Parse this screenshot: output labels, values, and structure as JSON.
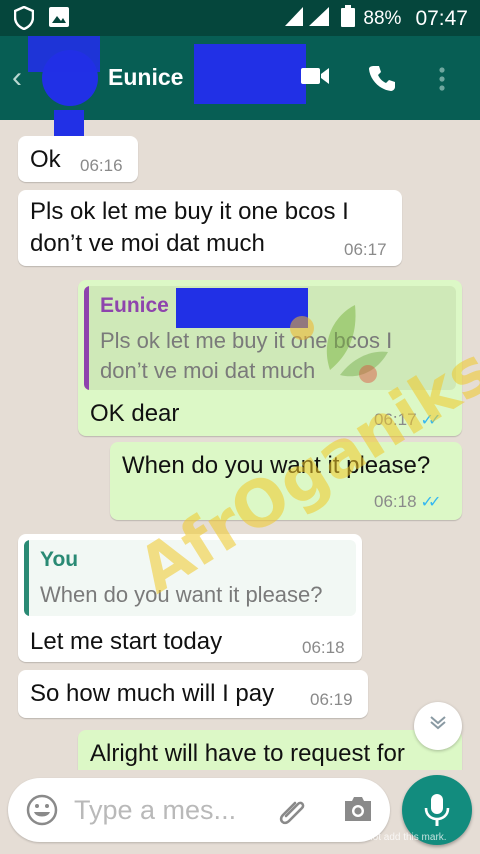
{
  "status_bar": {
    "battery": "88%",
    "time": "07:47"
  },
  "header": {
    "contact_name": "Eunice"
  },
  "messages": [
    {
      "text": "Ok",
      "time": "06:16"
    },
    {
      "text_lines": [
        "Pls ok let me buy it one bcos I",
        "don’t ve moi dat much"
      ],
      "time": "06:17"
    },
    {
      "quote_author": "Eunice",
      "quote_lines": [
        "Pls ok let me buy it one bcos I",
        "don’t ve moi dat much"
      ],
      "text": "OK dear",
      "time": "06:17"
    },
    {
      "text": "When do you want it please?",
      "time": "06:18"
    },
    {
      "quote_author": "You",
      "quote_text": "When do you want it please?",
      "text": "Let me start today",
      "time": "06:18"
    },
    {
      "text": "So how much will I pay",
      "time": "06:19"
    },
    {
      "text": "Alright will have to request for"
    }
  ],
  "input": {
    "placeholder": "Type a mes..."
  },
  "watermark": {
    "text": "AfrOganiks"
  },
  "footer_note": "Processed using the free version of Watermarkly. The paid version does not add this mark.",
  "colors": {
    "header": "#075e54",
    "status_bar": "#05463c",
    "incoming": "#ffffff",
    "outgoing": "#dcf8c6",
    "accent": "#128c7e",
    "read_ticks": "#34b7f1"
  },
  "icons": [
    "shield-icon",
    "image-icon",
    "signal-icon",
    "battery-icon",
    "back-arrow-icon",
    "video-call-icon",
    "phone-icon",
    "more-options-icon",
    "double-tick-icon",
    "chevron-down-icon",
    "emoji-icon",
    "attach-icon",
    "camera-icon",
    "mic-icon"
  ]
}
